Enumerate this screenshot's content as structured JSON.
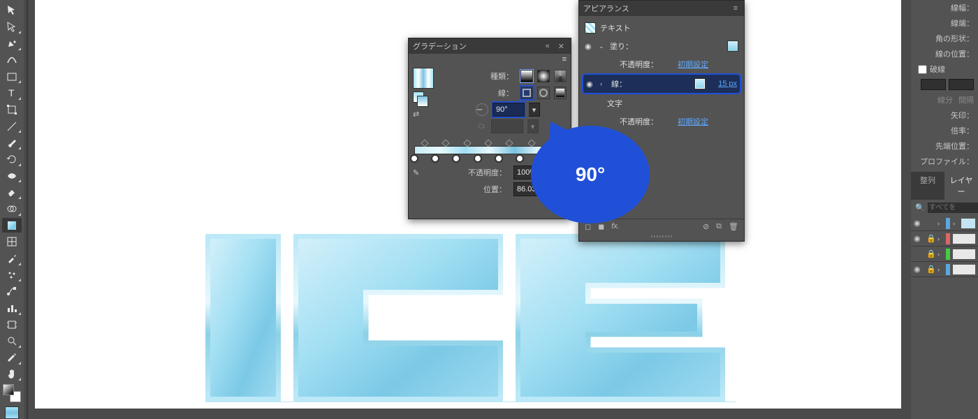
{
  "gradient_panel": {
    "title": "グラデーション",
    "type_label": "種類：",
    "stroke_label": "線：",
    "angle_value": "90°",
    "aspect_value": "",
    "opacity_label": "不透明度：",
    "opacity_value": "100%",
    "position_label": "位置：",
    "position_value": "86.0335%",
    "stops_pct": [
      0,
      14,
      28,
      42,
      56,
      70,
      86,
      100
    ],
    "midpoints_pct": [
      7,
      21,
      35,
      49,
      63,
      78,
      93
    ]
  },
  "appearance_panel": {
    "title": "アピアランス",
    "items": {
      "text_label": "テキスト",
      "fill_label": "塗り：",
      "stroke_label": "線：",
      "stroke_value": "15 px",
      "moji_label": "文字",
      "opacity_label": "不透明度：",
      "opacity_value": "初期設定"
    }
  },
  "rightpanel": {
    "labels": {
      "senpaku": "線幅：",
      "sentan": "線端：",
      "kado": "角の形状：",
      "senichi": "線の位置：",
      "hasen": "破線",
      "senbun": "線分",
      "kankaku": "間隔",
      "yain": "矢印：",
      "beiritsu": "倍率：",
      "sentanichi": "先端位置：",
      "profile": "プロファイル："
    },
    "tabs": {
      "seiretsu": "整列",
      "layer": "レイヤー"
    },
    "search_placeholder": "すべてを"
  },
  "callout": {
    "value": "90°"
  },
  "artwork_text": "ICE"
}
